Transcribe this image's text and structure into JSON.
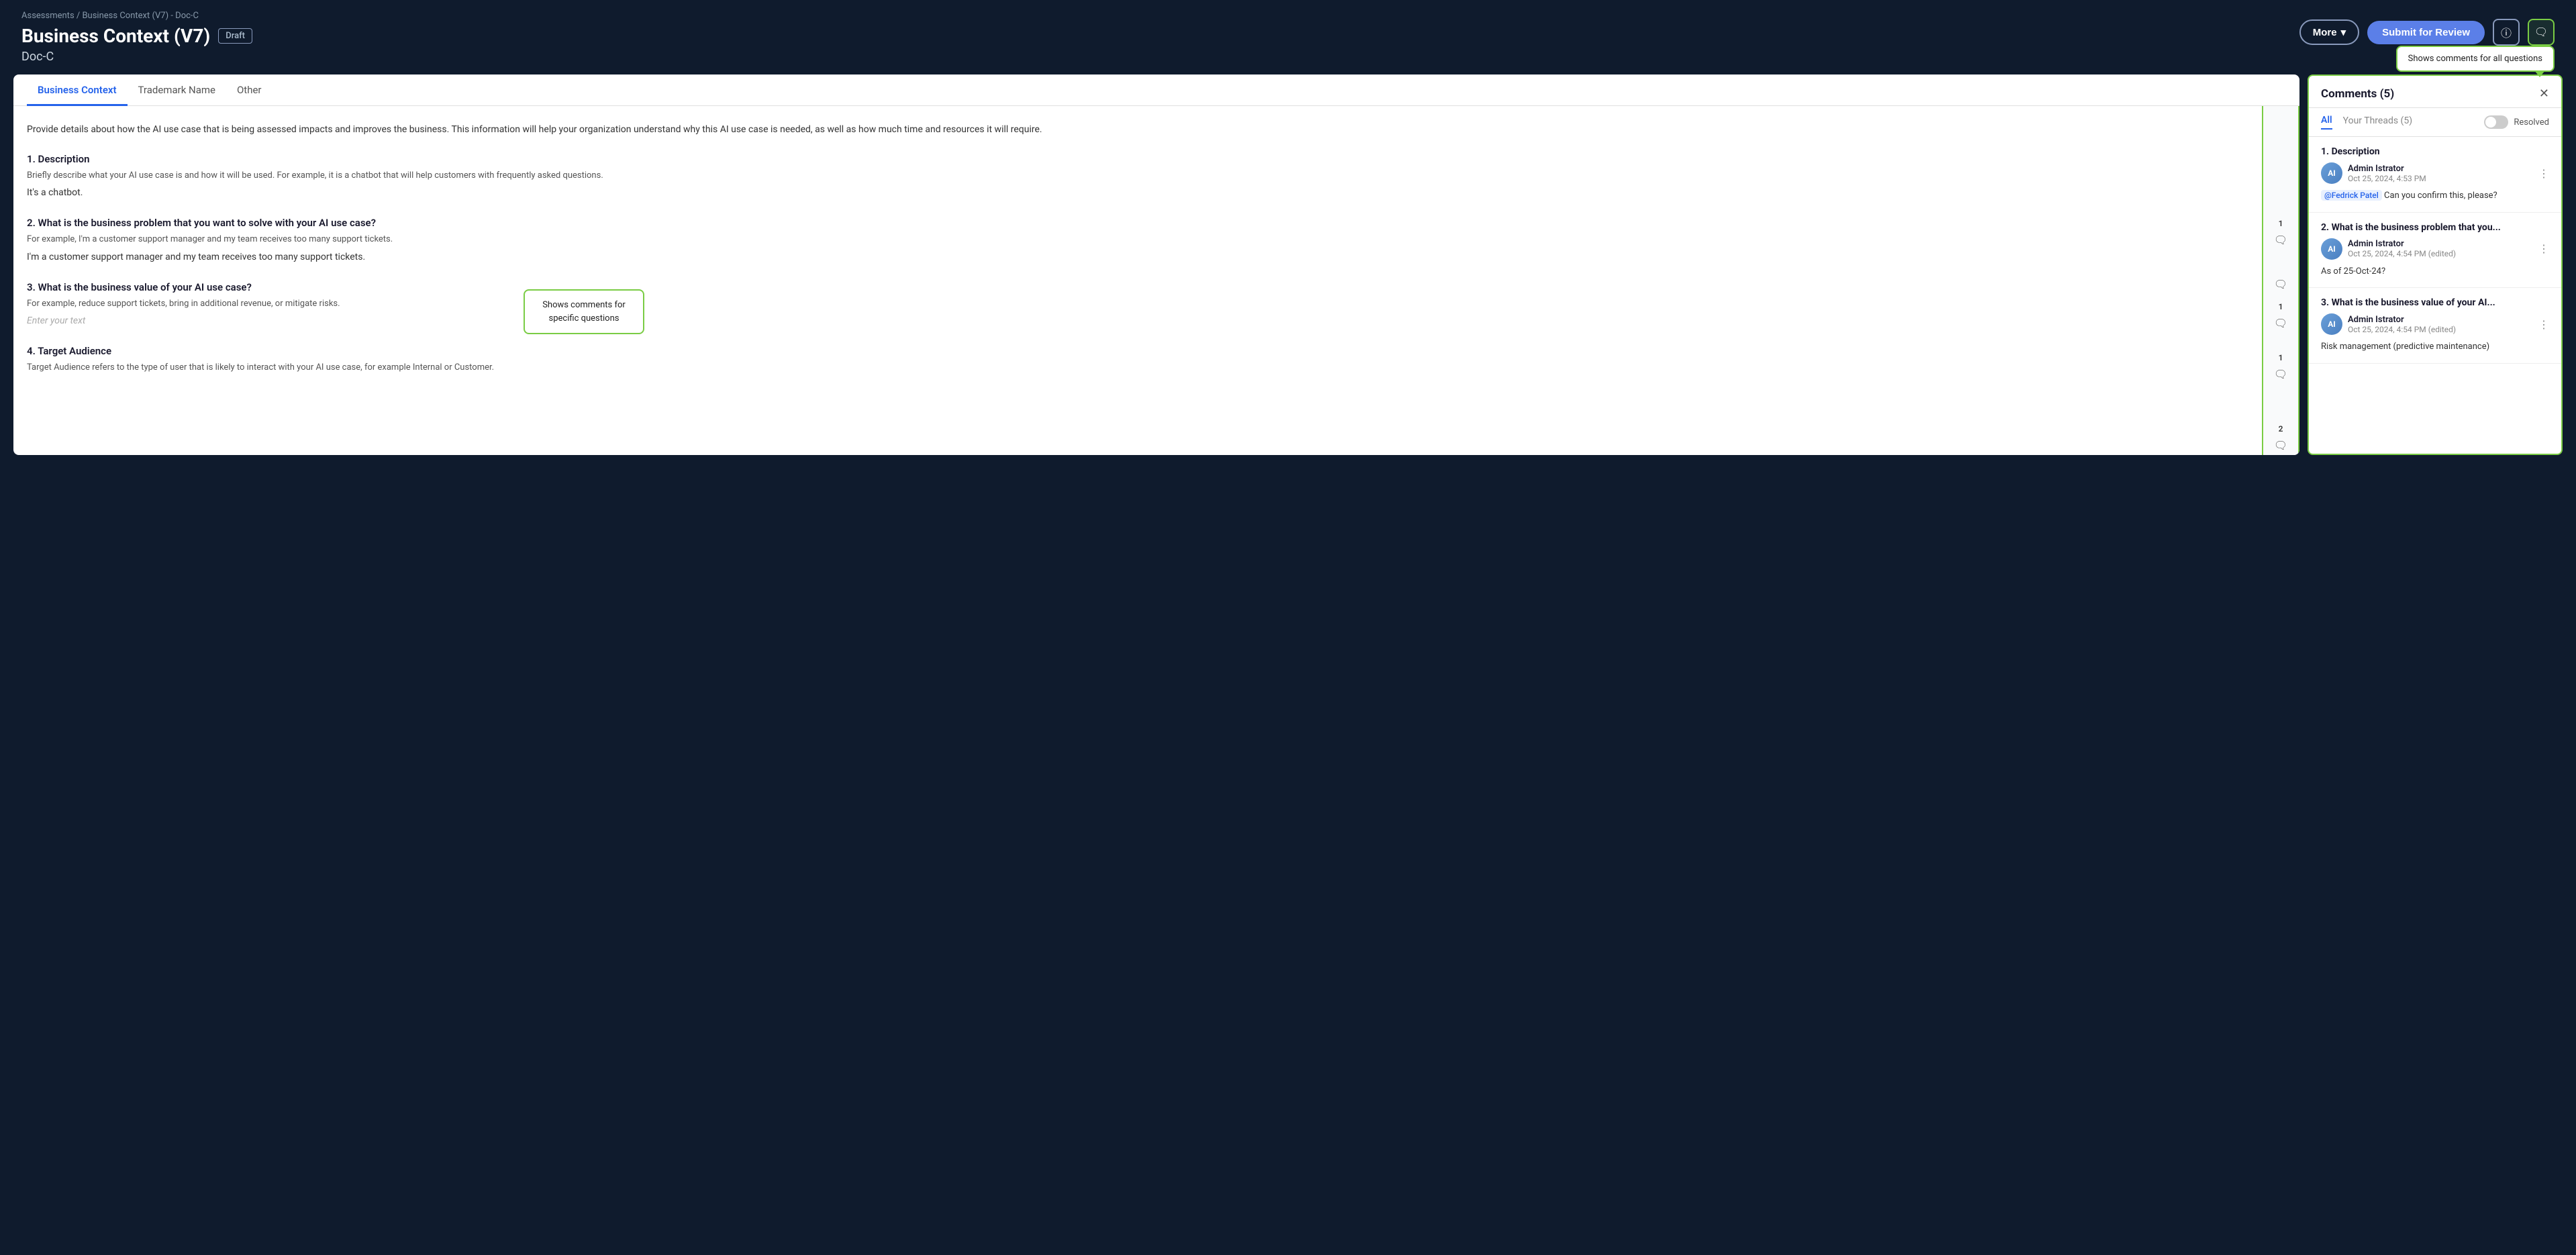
{
  "breadcrumb": {
    "text": "Assessments / Business Context (V7) - Doc-C"
  },
  "header": {
    "title": "Business Context (V7)",
    "badge": "Draft",
    "subtitle": "Doc-C",
    "more_label": "More",
    "submit_label": "Submit for Review",
    "tooltip_all": "Shows comments for all questions",
    "tooltip_specific": "Shows comments for specific questions"
  },
  "tabs": [
    {
      "label": "Business Context",
      "active": true
    },
    {
      "label": "Trademark Name",
      "active": false
    },
    {
      "label": "Other",
      "active": false
    }
  ],
  "form": {
    "intro": "Provide details about how the AI use case that is being assessed impacts and improves the business. This information will help your organization understand why this AI use case is needed, as well as how much time and resources it will require.",
    "questions": [
      {
        "id": 1,
        "title": "1. Description",
        "hint": "Briefly describe what your AI use case is and how it will be used. For example, it is a chatbot that will help customers with frequently asked questions.",
        "answer": "It's a chatbot.",
        "comment_count": 1
      },
      {
        "id": 2,
        "title": "2. What is the business problem that you want to solve with your AI use case?",
        "hint": "For example, I'm a customer support manager and my team receives too many support tickets.",
        "answer": "I'm a customer support manager and my team receives too many support tickets.",
        "comment_count": 1
      },
      {
        "id": 3,
        "title": "3. What is the business value of your AI use case?",
        "hint": "For example, reduce support tickets, bring in additional revenue, or mitigate risks.",
        "answer": "",
        "placeholder": "Enter your text",
        "comment_count": 1
      },
      {
        "id": 4,
        "title": "4. Target Audience",
        "hint": "Target Audience refers to the type of user that is likely to interact with your AI use case, for example Internal or Customer.",
        "answer": "",
        "comment_count": 2
      }
    ]
  },
  "comments": {
    "title": "Comments (5)",
    "filter_all": "All",
    "filter_threads": "Your Threads (5)",
    "filter_resolved": "Resolved",
    "items": [
      {
        "section": "1. Description",
        "author": "Admin Istrator",
        "time": "Oct 25, 2024, 4:53 PM",
        "mention": "@Fedrick Patel",
        "body": "Can you confirm this, please?"
      },
      {
        "section": "2. What is the business problem that you...",
        "author": "Admin Istrator",
        "time": "Oct 25, 2024, 4:54 PM (edited)",
        "body": "As of 25-Oct-24?"
      },
      {
        "section": "3. What is the business value of your AI...",
        "author": "Admin Istrator",
        "time": "Oct 25, 2024, 4:54 PM (edited)",
        "body": "Risk management (predictive maintenance)"
      }
    ]
  }
}
